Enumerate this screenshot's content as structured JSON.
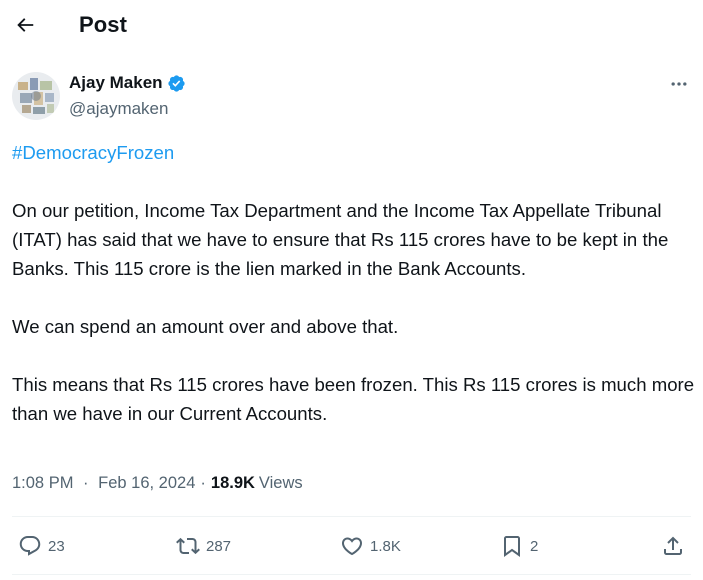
{
  "header": {
    "title": "Post",
    "back_icon": "arrow-left-icon"
  },
  "post": {
    "author": {
      "name": "Ajay Maken",
      "handle": "@ajaymaken",
      "verified": true,
      "verified_color": "#1d9bf0"
    },
    "hashtag": "#DemocracyFrozen",
    "paragraphs": [
      "On our petition, Income Tax Department and the Income Tax Appellate Tribunal (ITAT) has said that we have to ensure that Rs 115 crores have to be kept in the Banks. This 115 crore is the lien marked in the Bank Accounts.",
      "We can spend an amount over and above that.",
      "This means that Rs 115 crores have been frozen. This Rs 115 crores is much more than we have in our Current Accounts."
    ],
    "time": "1:08 PM",
    "date": "Feb 16, 2024",
    "separator": "·",
    "views_count": "18.9K",
    "views_label": "Views"
  },
  "actions": {
    "replies": {
      "icon": "reply-icon",
      "count": "23"
    },
    "reposts": {
      "icon": "repost-icon",
      "count": "287"
    },
    "likes": {
      "icon": "heart-icon",
      "count": "1.8K"
    },
    "bookmarks": {
      "icon": "bookmark-icon",
      "count": "2"
    },
    "share": {
      "icon": "share-icon"
    }
  },
  "colors": {
    "text": "#0f1419",
    "secondary": "#536471",
    "accent": "#1d9bf0",
    "divider": "#eff3f4"
  }
}
